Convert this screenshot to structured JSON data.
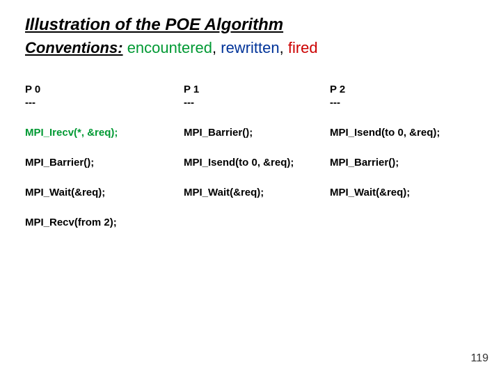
{
  "title": "Illustration of the POE Algorithm",
  "subtitle": {
    "conventions_label": "Conventions:",
    "encountered": "encountered",
    "rewritten": "rewritten",
    "fired": "fired",
    "sep": ", "
  },
  "columns": {
    "p0": {
      "label": "P 0",
      "dashes": "---"
    },
    "p1": {
      "label": "P 1",
      "dashes": "---"
    },
    "p2": {
      "label": "P 2",
      "dashes": "---"
    }
  },
  "rows": {
    "r1": {
      "c0": "MPI_Irecv(*, &req);",
      "c1": "MPI_Barrier();",
      "c2": "MPI_Isend(to 0, &req);"
    },
    "r2": {
      "c0": "MPI_Barrier();",
      "c1": "MPI_Isend(to 0, &req);",
      "c2": "MPI_Barrier();"
    },
    "r3": {
      "c0": "MPI_Wait(&req);",
      "c1": "MPI_Wait(&req);",
      "c2": "MPI_Wait(&req);"
    },
    "r4": {
      "c0": "MPI_Recv(from 2);"
    }
  },
  "page_number": "119"
}
